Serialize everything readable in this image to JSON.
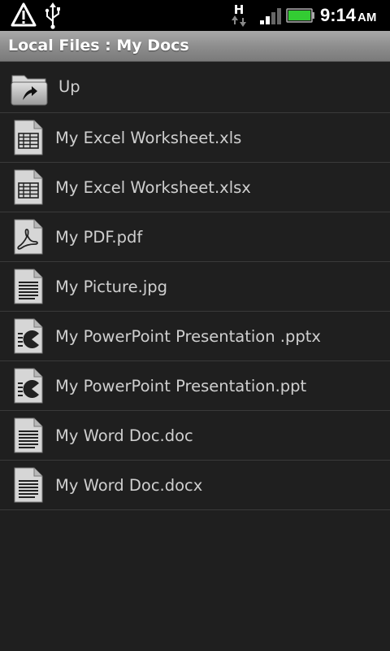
{
  "status_bar": {
    "network_type": "H",
    "time": "9:14",
    "time_suffix": "AM",
    "battery_color": "#33cc33"
  },
  "title_bar": {
    "title": "Local Files : My Docs"
  },
  "files": [
    {
      "label": "Up",
      "icon": "folder-up-icon"
    },
    {
      "label": "My Excel Worksheet.xls",
      "icon": "spreadsheet-icon"
    },
    {
      "label": "My Excel Worksheet.xlsx",
      "icon": "spreadsheet-icon"
    },
    {
      "label": "My PDF.pdf",
      "icon": "pdf-icon"
    },
    {
      "label": "My Picture.jpg",
      "icon": "document-icon"
    },
    {
      "label": "My PowerPoint Presentation .pptx",
      "icon": "presentation-icon"
    },
    {
      "label": "My PowerPoint Presentation.ppt",
      "icon": "presentation-icon"
    },
    {
      "label": "My Word Doc.doc",
      "icon": "document-icon"
    },
    {
      "label": "My Word Doc.docx",
      "icon": "document-icon"
    }
  ]
}
